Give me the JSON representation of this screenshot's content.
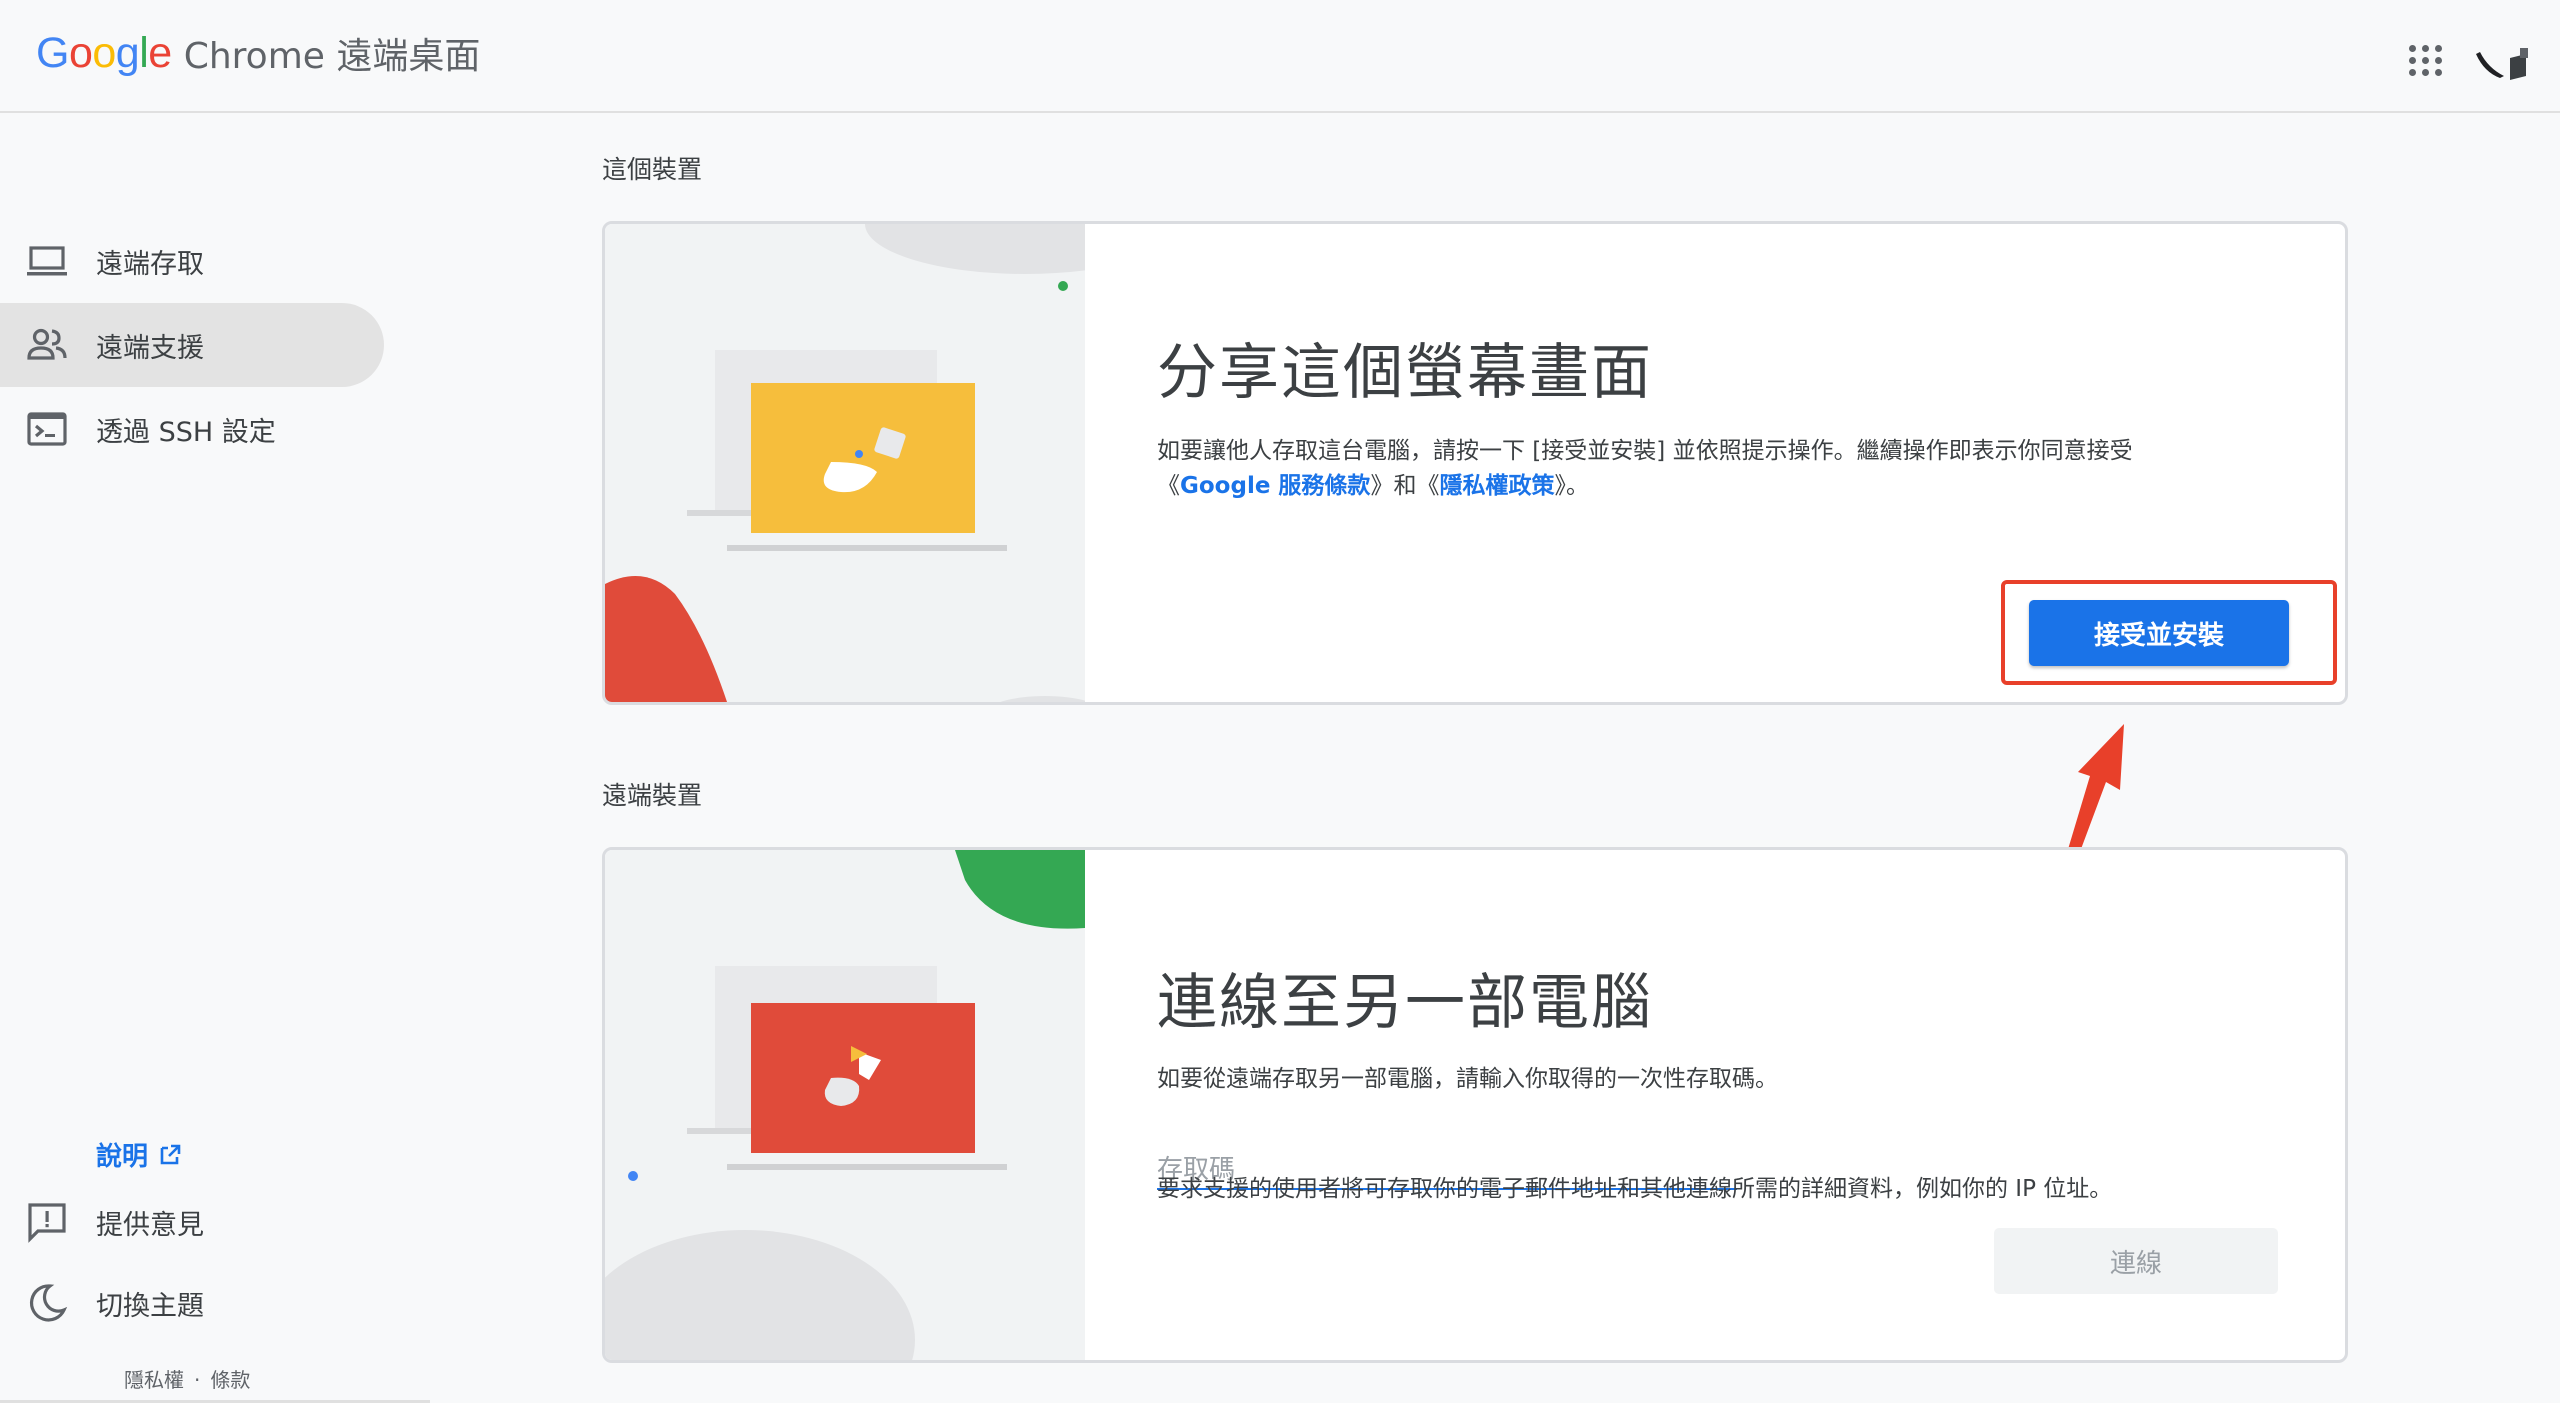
{
  "header": {
    "logo_letters": [
      "G",
      "o",
      "o",
      "g",
      "l",
      "e"
    ],
    "logo_colors": [
      "#4285F4",
      "#EA4335",
      "#FBBC05",
      "#4285F4",
      "#34A853",
      "#EA4335"
    ],
    "product_name": "Chrome 遠端桌面",
    "apps_icon": "apps-grid-icon",
    "avatar_icon": "account-avatar"
  },
  "sidebar": {
    "items": [
      {
        "label": "遠端存取",
        "icon": "laptop-icon",
        "active": false
      },
      {
        "label": "遠端支援",
        "icon": "people-icon",
        "active": true
      },
      {
        "label": "透過 SSH 設定",
        "icon": "terminal-icon",
        "active": false
      }
    ],
    "help_label": "說明",
    "feedback_label": "提供意見",
    "theme_label": "切換主題",
    "privacy_label": "隱私權",
    "footer_separator": "·",
    "terms_label": "條款"
  },
  "this_device": {
    "section_title": "這個裝置",
    "card_title": "分享這個螢幕畫面",
    "desc_part1": "如要讓他人存取這台電腦，請按一下 [接受並安裝] 並依照提示操作。繼續操作即表示你同意接受",
    "desc_open1": "《",
    "desc_link1": "Google 服務條款",
    "desc_mid": "》和《",
    "desc_link2": "隱私權政策",
    "desc_end": "》。",
    "accept_button": "接受並安裝"
  },
  "remote_device": {
    "section_title": "遠端裝置",
    "card_title": "連線至另一部電腦",
    "desc": "如要從遠端存取另一部電腦，請輸入你取得的一次性存取碼。",
    "code_placeholder": "存取碼",
    "note": "要求支援的使用者將可存取你的電子郵件地址和其他連線所需的詳細資料，例如你的 IP 位址。",
    "connect_button": "連線"
  },
  "colors": {
    "primary_blue": "#1a73e8",
    "annotation_red": "#e8402a",
    "illus_yellow": "#f6be3c",
    "illus_red": "#e04b3a",
    "illus_green": "#34a853"
  }
}
